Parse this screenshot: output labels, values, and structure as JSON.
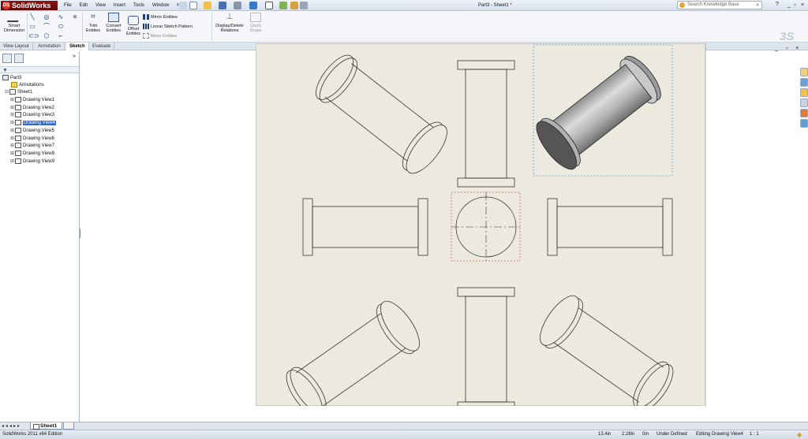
{
  "app": {
    "name": "SolidWorks",
    "logo_mark": "DS",
    "document_title": "Part3 - Sheet1 *"
  },
  "menu": [
    "File",
    "Edit",
    "View",
    "Insert",
    "Tools",
    "Window",
    "Help"
  ],
  "search": {
    "placeholder": "Search Knowledge Base"
  },
  "window_controls": {
    "help": "?",
    "minimize": "_",
    "restore": "▫",
    "close": "×"
  },
  "ribbon": {
    "smart_dimension": "Smart Dimension",
    "trim": "Trim Entities",
    "convert": "Convert Entities",
    "offset": "Offset Entities",
    "mirror": "Mirror Entities",
    "linear_pattern": "Linear Sketch Pattern",
    "move": "Move Entities",
    "display_relations": "Display/Delete Relations",
    "quick_snaps": "Quick Snaps"
  },
  "tabs": [
    "View Layout",
    "Annotation",
    "Sketch",
    "Evaluate"
  ],
  "active_tab": "Sketch",
  "tree": {
    "root": "Part3",
    "annotations": "Annotations",
    "sheet": "Sheet1",
    "views": [
      "Drawing View1",
      "Drawing View2",
      "Drawing View3",
      "Drawing View4",
      "Drawing View5",
      "Drawing View6",
      "Drawing View7",
      "Drawing View8",
      "Drawing View9"
    ],
    "selected": "Drawing View4"
  },
  "sheet_tab": "Sheet1",
  "status": {
    "edition": "SolidWorks 2011 x64 Edition",
    "x": "13.4in",
    "y": "2.28in",
    "z": "0in",
    "definition": "Under Defined",
    "editing": "Editing Drawing View4",
    "scale": "1 : 1"
  },
  "colors": {
    "sheet_bg": "#eceade",
    "selection_blue": "#3366cc",
    "brand_red": "#8a1515"
  }
}
